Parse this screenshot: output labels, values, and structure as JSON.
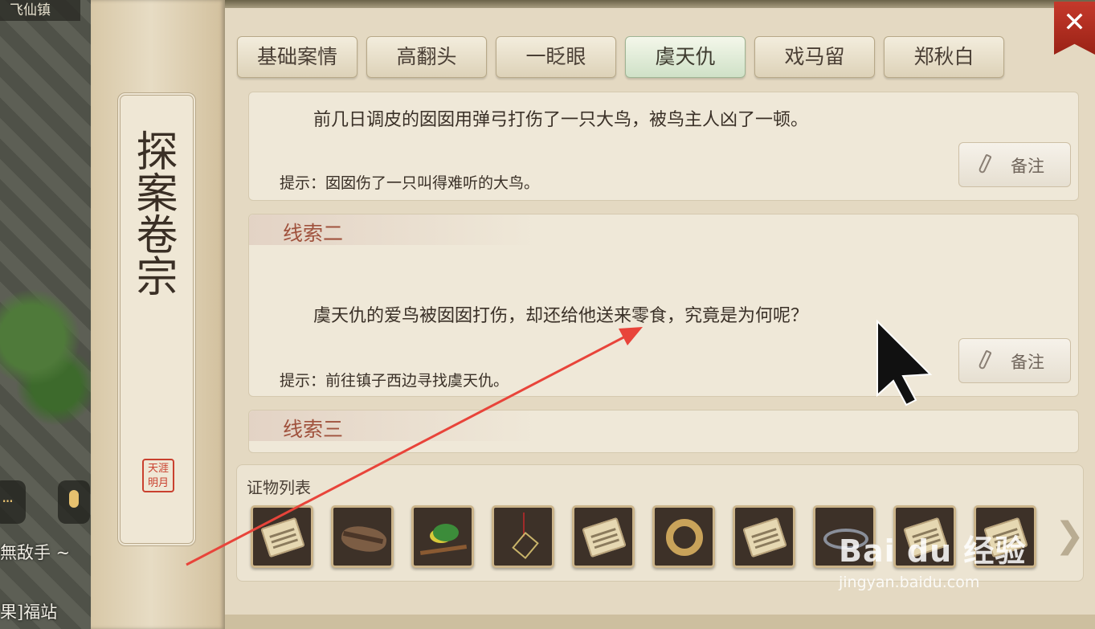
{
  "location": "飞仙镇",
  "side_texts": [
    "無敌手 ~",
    "果]福站"
  ],
  "scroll": {
    "title": "探案卷宗",
    "seal_text": "天涯明月"
  },
  "tabs": [
    {
      "label": "基础案情",
      "active": false
    },
    {
      "label": "高翻头",
      "active": false
    },
    {
      "label": "一眨眼",
      "active": false
    },
    {
      "label": "虞天仇",
      "active": true
    },
    {
      "label": "戏马留",
      "active": false
    },
    {
      "label": "郑秋白",
      "active": false
    }
  ],
  "close_label": "✕",
  "clues": [
    {
      "label": "",
      "body": "前几日调皮的囡囡用弹弓打伤了一只大鸟，被鸟主人凶了一顿。",
      "hint": "提示：囡囡伤了一只叫得难听的大鸟。",
      "note_label": "备注"
    },
    {
      "label": "线索二",
      "body": "虞天仇的爱鸟被囡囡打伤，却还给他送来零食，究竟是为何呢？",
      "hint": "提示：前往镇子西边寻找虞天仇。",
      "note_label": "备注"
    },
    {
      "label": "线索三"
    }
  ],
  "evidence": {
    "title": "证物列表",
    "items": [
      {
        "icon": "scroll-icon"
      },
      {
        "icon": "dead-bird-icon"
      },
      {
        "icon": "bird-icon"
      },
      {
        "icon": "pendant-icon"
      },
      {
        "icon": "scroll-icon"
      },
      {
        "icon": "ring-icon"
      },
      {
        "icon": "scroll-icon"
      },
      {
        "icon": "crown-icon"
      },
      {
        "icon": "scroll-icon"
      },
      {
        "icon": "scroll-icon"
      }
    ],
    "next_label": "❯"
  },
  "watermark": {
    "logo": "Bai du 经验",
    "url": "jingyan.baidu.com"
  },
  "colors": {
    "accent_red": "#c9402e",
    "annotation_arrow": "#e8443a",
    "active_tab": "#cfe1c7",
    "clue_label": "#a0523d"
  }
}
